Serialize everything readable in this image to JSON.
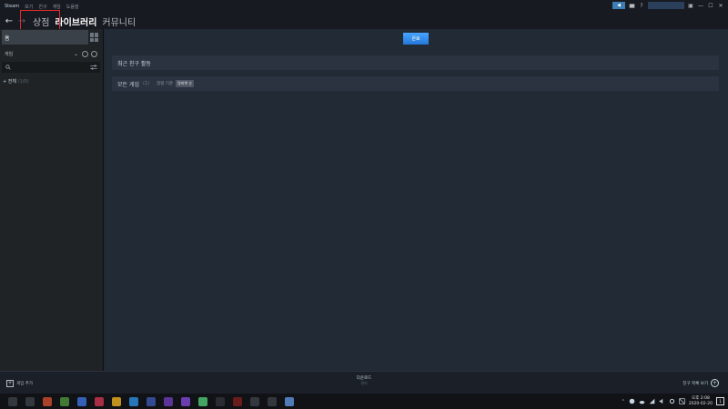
{
  "menubar": {
    "items": [
      "Steam",
      "보기",
      "친구",
      "게임",
      "도움말"
    ]
  },
  "window": {
    "account_name": "",
    "blue_button_glyph": "◀",
    "controls": [
      "▣",
      "—",
      "☐",
      "✕"
    ],
    "help_glyph": "?"
  },
  "nav": {
    "back_glyph": "←",
    "forward_glyph": "→",
    "tabs": [
      {
        "label": "상점",
        "active": false
      },
      {
        "label": "라이브러리",
        "active": true
      },
      {
        "label": "커뮤니티",
        "active": false
      }
    ],
    "highlight_color": "#e02b2b"
  },
  "sidebar": {
    "home_label": "홈",
    "filter_label": "게임",
    "filter_chevron": "⌄",
    "search_placeholder": "",
    "all_label": "+ 전체",
    "all_count": "(1/0)",
    "add_game_label": "게임 추가"
  },
  "main": {
    "done_button": "완료",
    "recent_activity": "최근 친구 활동",
    "all_games_label": "모든 게임",
    "all_games_count": "(1)",
    "sort_label": "정렬 기준",
    "sort_value": "알파벳 순"
  },
  "bottombar": {
    "download_label": "다운로드",
    "download_sub": "관리",
    "friends_label": "친구 목록 보기"
  },
  "taskbar": {
    "time": "오후 2:08",
    "date": "2020-02-20",
    "notif_count": "1",
    "icon_colors": [
      "#3a3f47",
      "#3a3f47",
      "#c84a2e",
      "#4a8d3a",
      "#3b6fd1",
      "#c4344b",
      "#e0a81e",
      "#2a8ad6",
      "#3a55a8",
      "#6a3ab0",
      "#7b45c9",
      "#4cbf6e",
      "#2e3338",
      "#7a1e1e",
      "#3a3f47",
      "#3a3f47",
      "#5b8fd6"
    ]
  },
  "colors": {
    "accent": "#1a9fff",
    "background": "#1b2838"
  }
}
